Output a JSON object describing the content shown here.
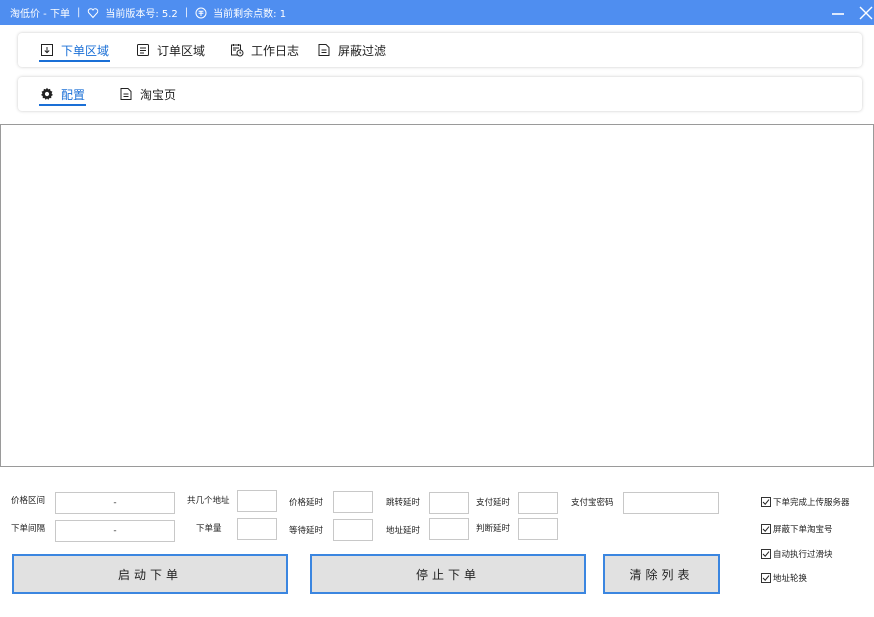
{
  "titlebar": {
    "app_title": "淘低价 - 下单",
    "separator": "|",
    "version_label": "当前版本号: 5.2",
    "points_label": "当前剩余点数: 1",
    "bg_color": "#4f8ef0"
  },
  "main_nav": {
    "tabs": [
      {
        "label": "下单区域",
        "icon": "download-file-icon",
        "active": true
      },
      {
        "label": "订单区域",
        "icon": "document-list-icon",
        "active": false
      },
      {
        "label": "工作日志",
        "icon": "calendar-clock-icon",
        "active": false
      },
      {
        "label": "屏蔽过滤",
        "icon": "document-icon",
        "active": false
      }
    ]
  },
  "sub_nav": {
    "tabs": [
      {
        "label": "配置",
        "icon": "gear-icon",
        "active": true
      },
      {
        "label": "淘宝页",
        "icon": "document-icon",
        "active": false
      }
    ]
  },
  "form": {
    "price_range_label": "价格区间",
    "price_range_value": "-",
    "order_interval_label": "下单间隔",
    "order_interval_value": "-",
    "address_count_label": "共几个地址",
    "address_count_value": "",
    "order_qty_label": "下单量",
    "order_qty_value": "",
    "price_delay_label": "价格延时",
    "price_delay_value": "",
    "wait_delay_label": "等待延时",
    "wait_delay_value": "",
    "jump_delay_label": "跳转延时",
    "jump_delay_value": "",
    "address_delay_label": "地址延时",
    "address_delay_value": "",
    "pay_delay_label": "支付延时",
    "pay_delay_value": "",
    "judge_delay_label": "判断延时",
    "judge_delay_value": "",
    "alipay_password_label": "支付宝密码",
    "alipay_password_value": ""
  },
  "buttons": {
    "start": "启动下单",
    "stop": "停止下单",
    "clear": "清除列表",
    "border_color": "#3b86e0"
  },
  "checkboxes": [
    {
      "label": "下单完成上传服务器",
      "checked": true
    },
    {
      "label": "屏蔽下单淘宝号",
      "checked": true
    },
    {
      "label": "自动执行过滑块",
      "checked": true
    },
    {
      "label": "地址轮换",
      "checked": true
    }
  ]
}
